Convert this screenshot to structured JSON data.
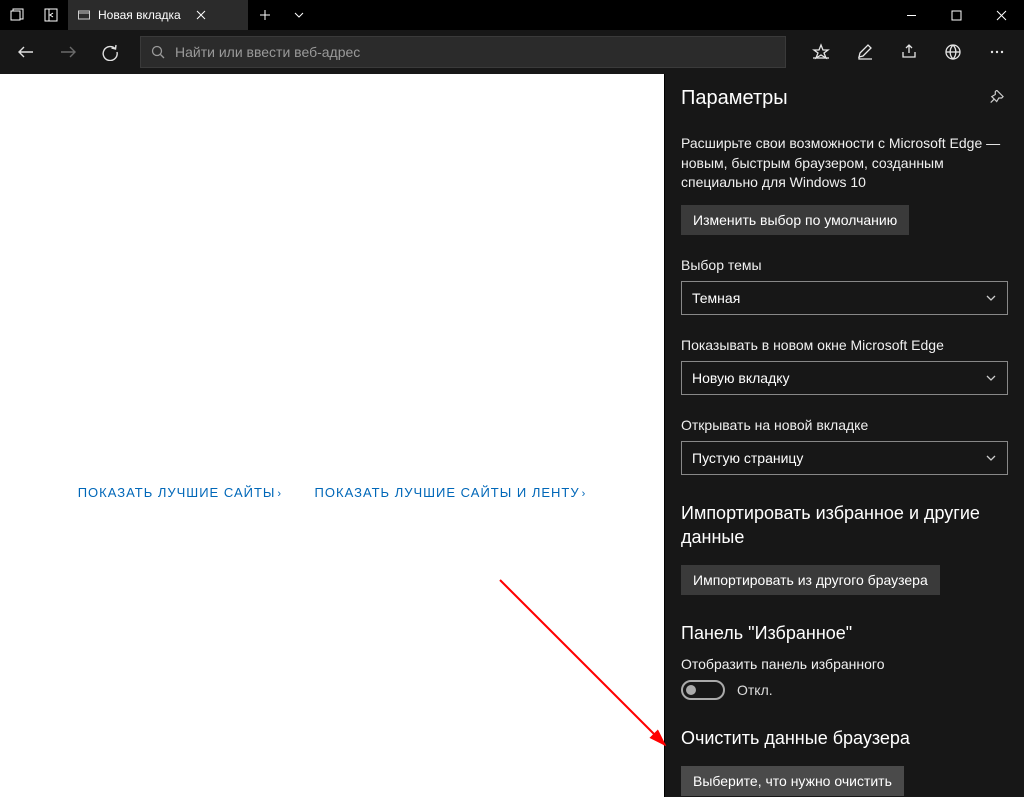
{
  "tab": {
    "title": "Новая вкладка"
  },
  "addressbar": {
    "placeholder": "Найти или ввести веб-адрес"
  },
  "content": {
    "link1": "ПОКАЗАТЬ ЛУЧШИЕ САЙТЫ",
    "link2": "ПОКАЗАТЬ ЛУЧШИЕ САЙТЫ И ЛЕНТУ"
  },
  "panel": {
    "title": "Параметры",
    "promo": "Расширьте свои возможности с Microsoft Edge — новым, быстрым браузером, созданным специально для Windows 10",
    "change_default_btn": "Изменить выбор по умолчанию",
    "theme_label": "Выбор темы",
    "theme_value": "Темная",
    "open_with_label": "Показывать в новом окне Microsoft Edge",
    "open_with_value": "Новую вкладку",
    "new_tab_label": "Открывать на новой вкладке",
    "new_tab_value": "Пустую страницу",
    "import_heading": "Импортировать избранное и другие данные",
    "import_btn": "Импортировать из другого браузера",
    "fav_heading": "Панель \"Избранное\"",
    "fav_toggle_label": "Отобразить панель избранного",
    "fav_toggle_state": "Откл.",
    "clear_heading": "Очистить данные браузера",
    "clear_btn": "Выберите, что нужно очистить"
  }
}
